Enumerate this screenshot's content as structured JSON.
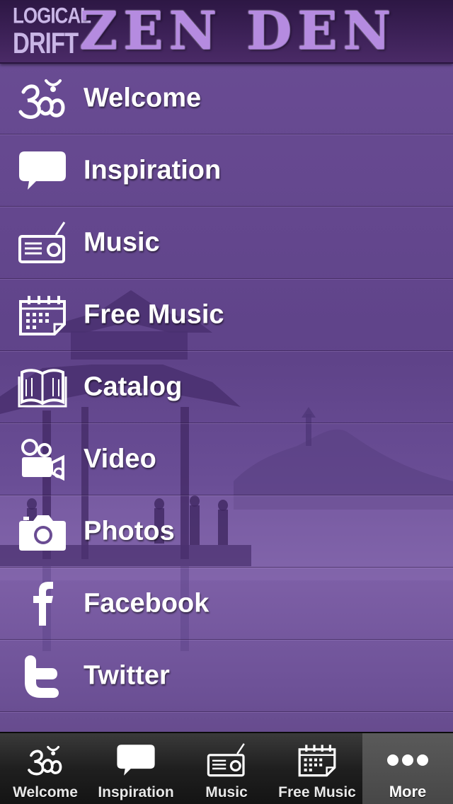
{
  "header": {
    "brand_line1": "LOGICAL",
    "brand_line2": "DRIFT",
    "title": "ZEN DEN"
  },
  "menu": {
    "items": [
      {
        "label": "Welcome",
        "icon": "om-icon"
      },
      {
        "label": "Inspiration",
        "icon": "speech-bubble-icon"
      },
      {
        "label": "Music",
        "icon": "radio-icon"
      },
      {
        "label": "Free Music",
        "icon": "calendar-icon"
      },
      {
        "label": "Catalog",
        "icon": "open-book-icon"
      },
      {
        "label": "Video",
        "icon": "video-camera-icon"
      },
      {
        "label": "Photos",
        "icon": "camera-icon"
      },
      {
        "label": "Facebook",
        "icon": "facebook-icon"
      },
      {
        "label": "Twitter",
        "icon": "twitter-icon"
      }
    ]
  },
  "tabbar": {
    "tabs": [
      {
        "label": "Welcome",
        "icon": "om-icon"
      },
      {
        "label": "Inspiration",
        "icon": "speech-bubble-icon"
      },
      {
        "label": "Music",
        "icon": "radio-icon"
      },
      {
        "label": "Free Music",
        "icon": "calendar-icon"
      },
      {
        "label": "More",
        "icon": "more-dots-icon",
        "active": true
      }
    ]
  },
  "colors": {
    "header_bg": "#3e2259",
    "title_text": "#b58be0",
    "menu_bg": "#6b4d95",
    "menu_text": "#ffffff",
    "tabbar_bg": "#1f1f1f",
    "tab_active_bg": "#4d4d4d"
  }
}
